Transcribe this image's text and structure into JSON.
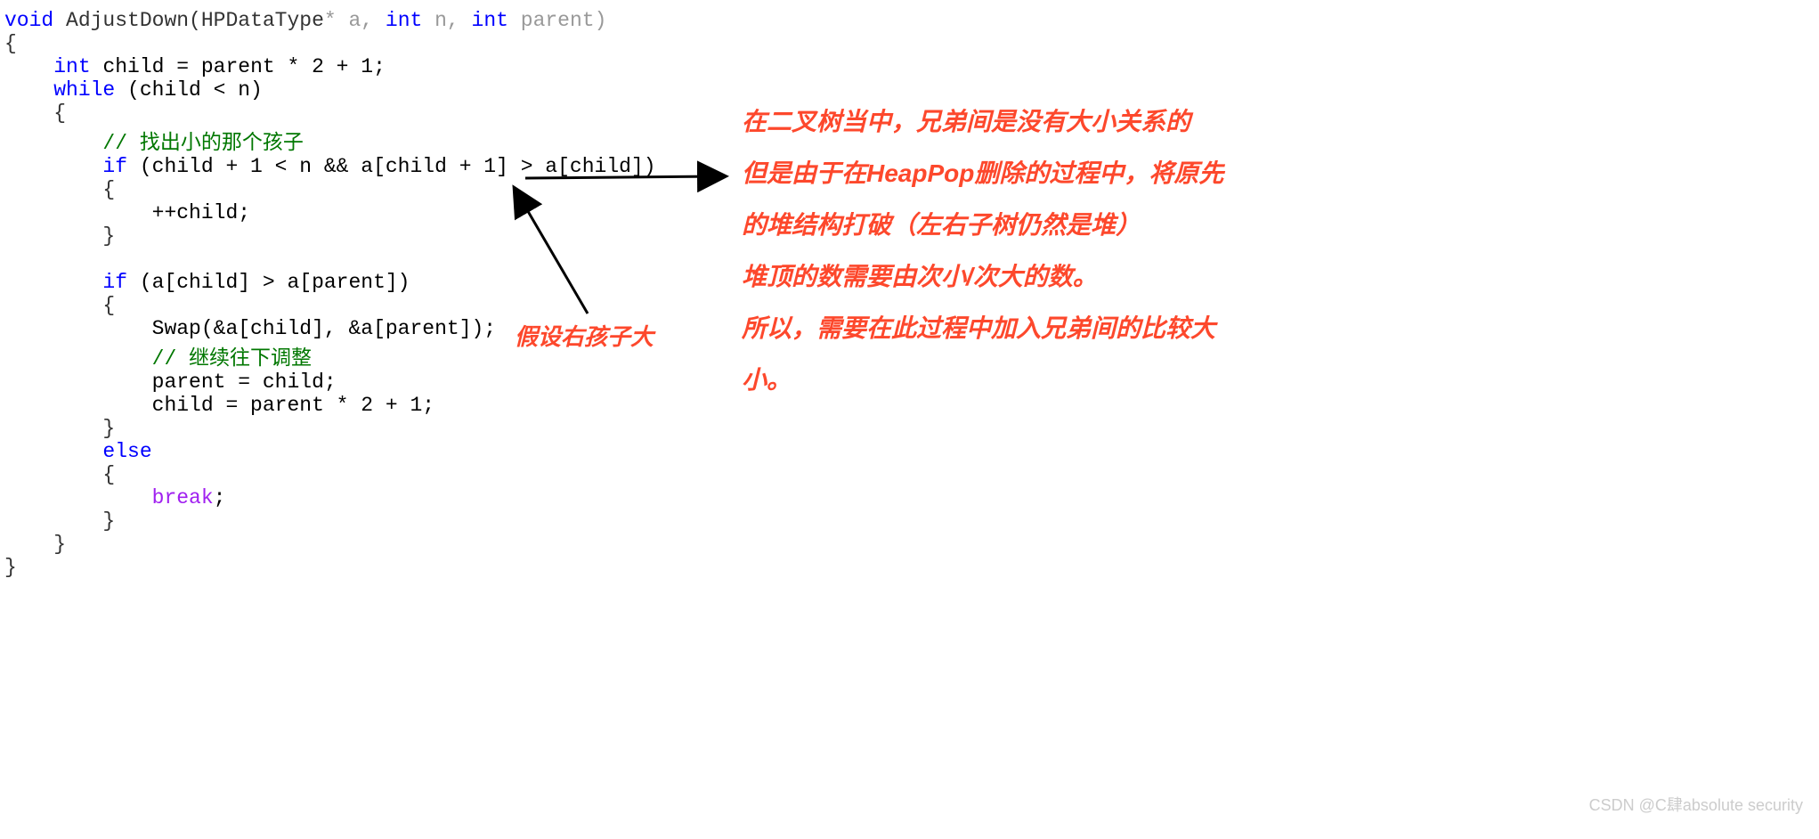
{
  "code": {
    "l1_void": "void",
    "l1_fn": " AdjustDown(",
    "l1_t1": "HPDataType",
    "l1_p1": "* a, ",
    "l1_int1": "int",
    "l1_p2": " n, ",
    "l1_int2": "int",
    "l1_p3": " parent)",
    "l3_int": "int",
    "l3_rest": " child = parent * 2 + 1;",
    "l4_while": "while",
    "l4_cond": " (child < n)",
    "l6_c": "// 找出小的那个孩子",
    "l7_if": "if",
    "l7_cond": " (child + 1 < n && a[child + 1] > a[child])",
    "l9_inc": "++child;",
    "l12_if": "if",
    "l12_cond": " (a[child] > a[parent])",
    "l14_swap": "Swap(&a[child], &a[parent]);",
    "l15_c": "// 继续往下调整",
    "l16": "parent = child;",
    "l17": "child = parent * 2 + 1;",
    "l19_else": "else",
    "l21_break": "break",
    "l21_semi": ";"
  },
  "annotation": {
    "right_block_l1": "在二叉树当中，兄弟间是没有大小关系的",
    "right_block_l2": "但是由于在HeapPop删除的过程中，将原先",
    "right_block_l3": "的堆结构打破（左右子树仍然是堆）",
    "right_block_l4": "堆顶的数需要由次小/次大的数。",
    "right_block_l5": "所以，需要在此过程中加入兄弟间的比较大",
    "right_block_l6": "小。",
    "hint_label": "假设右孩子大"
  },
  "watermark": "CSDN @C肆absolute security"
}
